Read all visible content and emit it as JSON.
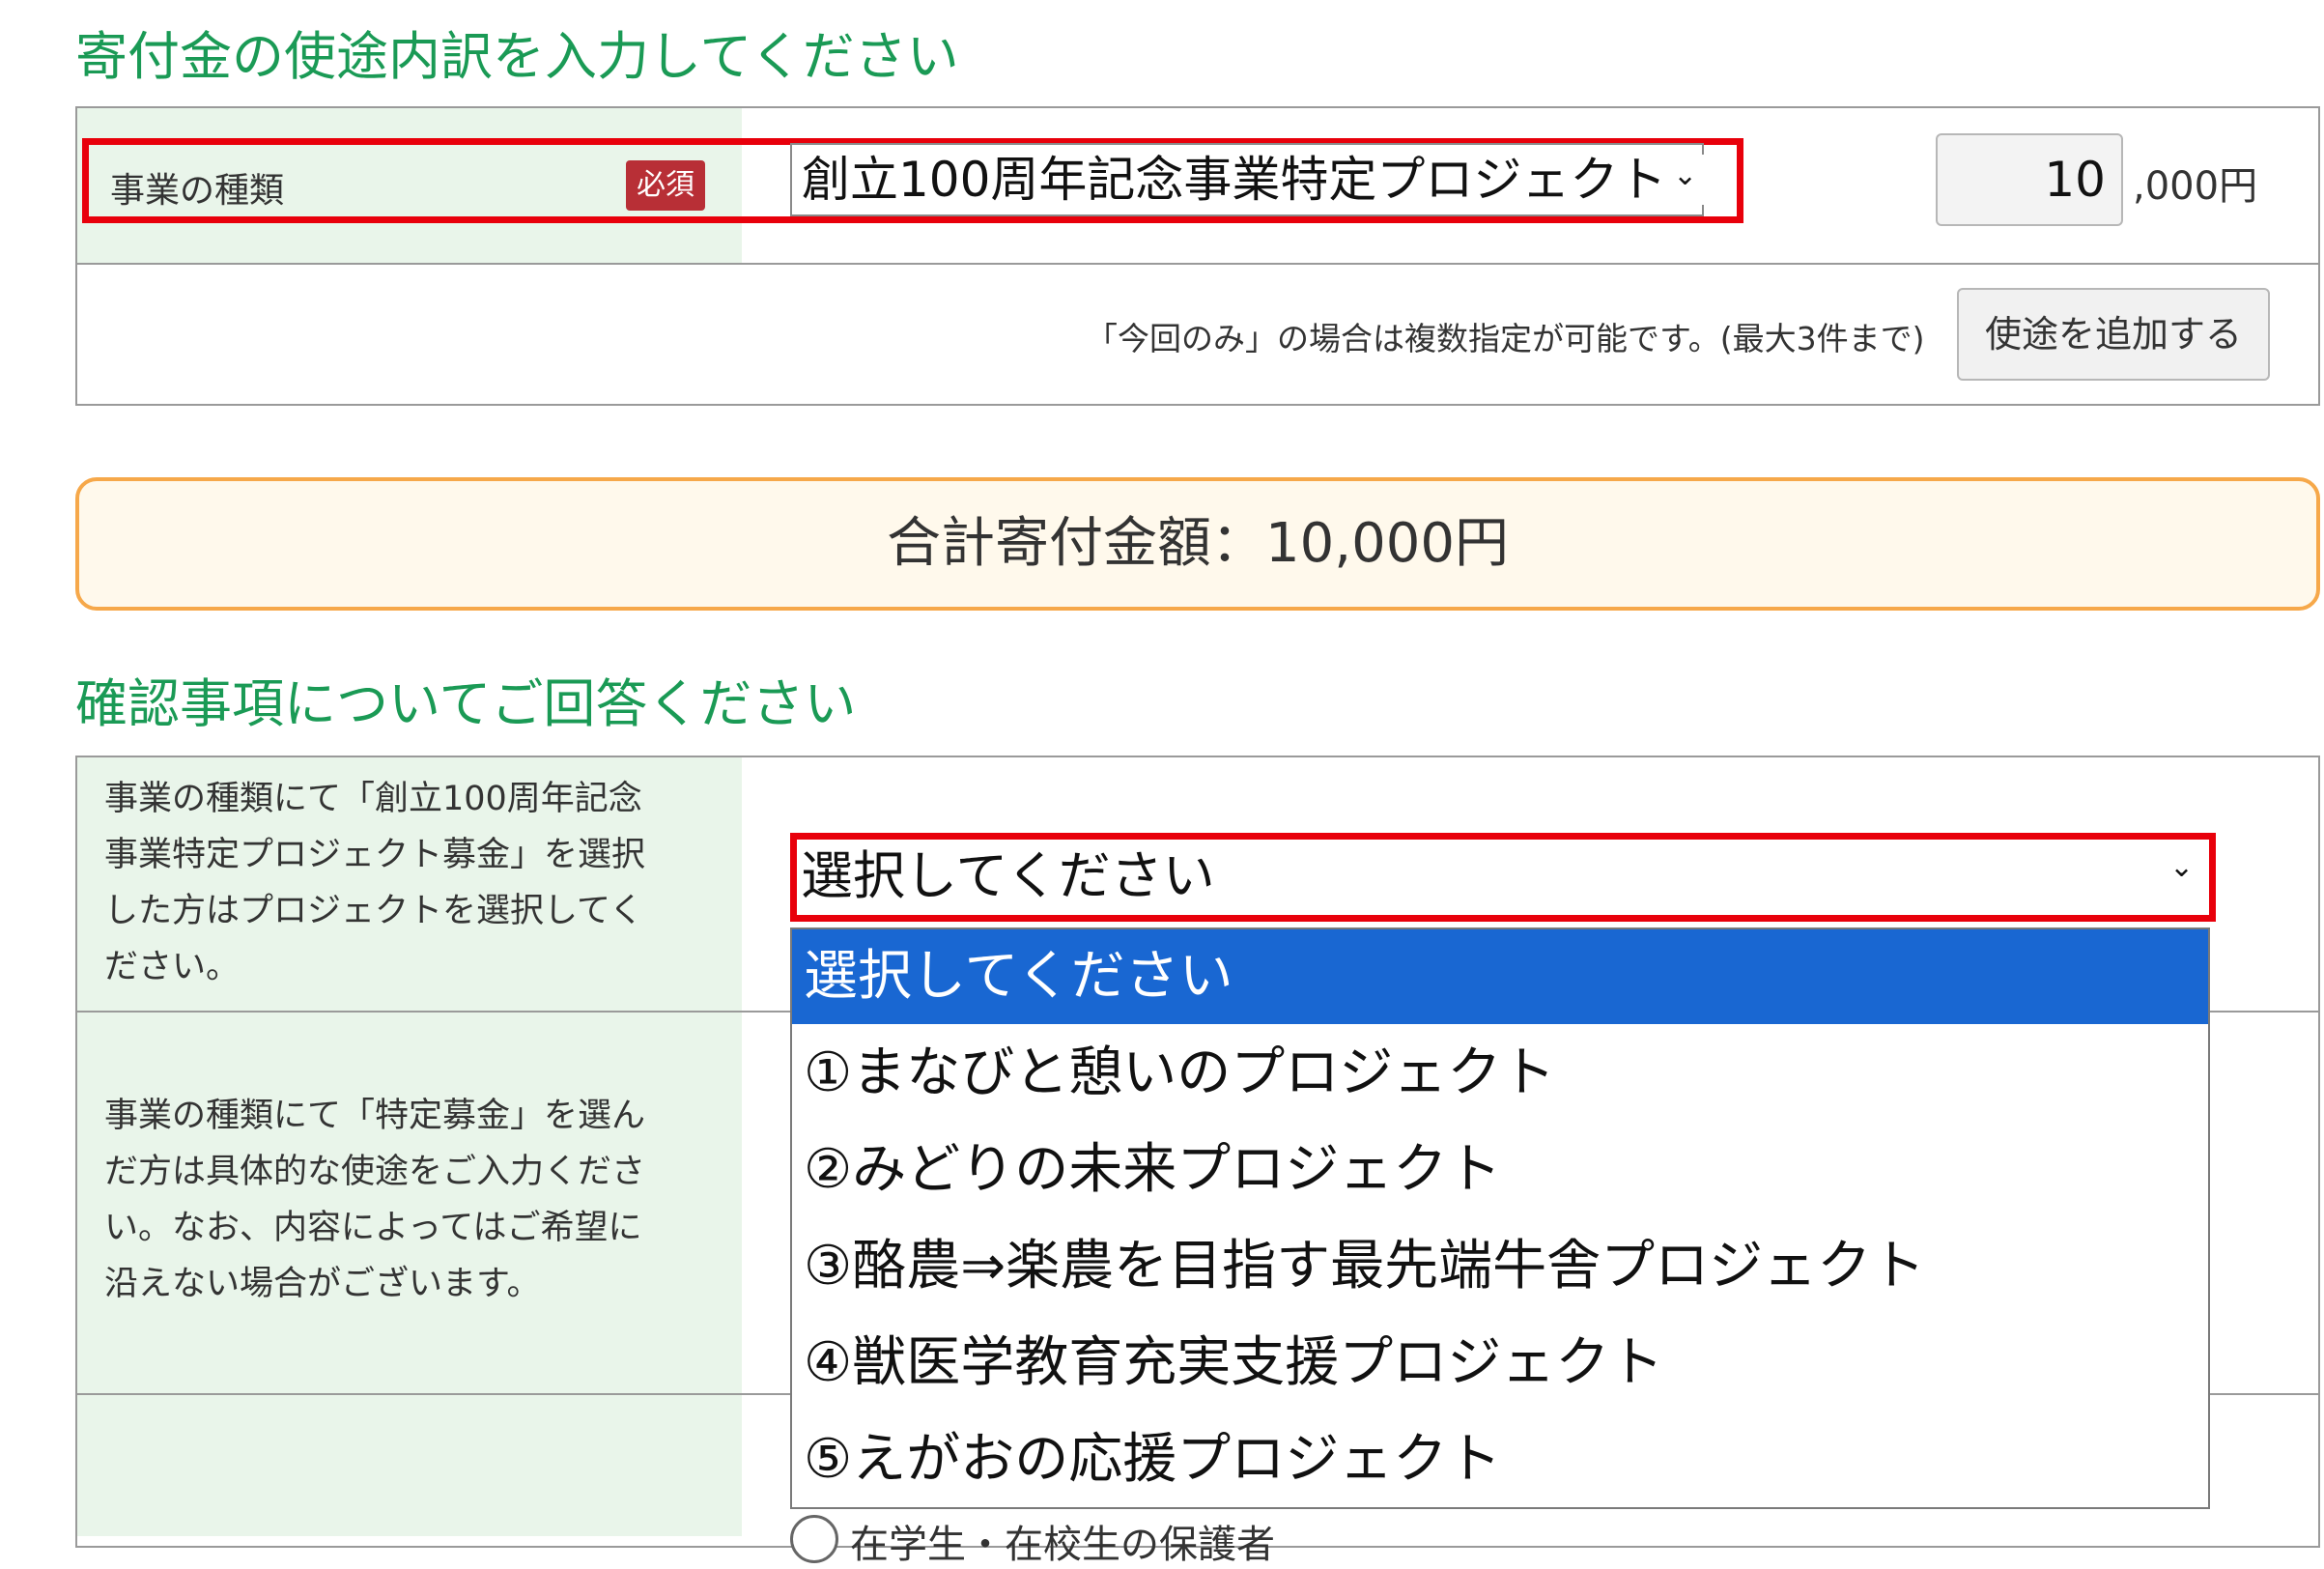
{
  "section1": {
    "title": "寄付金の使途内訳を入力してください",
    "business_type_label": "事業の種類",
    "required_badge": "必須",
    "business_type_value": "創立100周年記念事業特定プロジェクト",
    "amount_value": "10",
    "amount_suffix": ",000円",
    "note": "「今回のみ」の場合は複数指定が可能です。(最大3件まで)",
    "add_button": "使途を追加する"
  },
  "total": {
    "text": "合計寄付金額：10,000円"
  },
  "section2": {
    "title": "確認事項についてご回答ください",
    "q1_lines": [
      "事業の種類にて「創立100周年記念",
      "事業特定プロジェクト募金」を選択",
      "した方はプロジェクトを選択してく",
      "ださい。"
    ],
    "q1_select_value": "選択してください",
    "q2_lines": [
      "事業の種類にて「特定募金」を選ん",
      "だ方は具体的な使途をご入力くださ",
      "い。なお、内容によってはご希望に",
      "沿えない場合がございます。"
    ],
    "partial_radio_text": "在学生・在校生の保護者"
  },
  "dropdown": {
    "options": [
      "選択してください",
      "①まなびと憩いのプロジェクト",
      "②みどりの未来プロジェクト",
      "③酪農⇒楽農を目指す最先端牛舎プロジェクト",
      "④獣医学教育充実支援プロジェクト",
      "⑤えがおの応援プロジェクト"
    ],
    "selected_index": 0
  },
  "colors": {
    "heading": "#1a9a55",
    "label_bg": "#e9f5ea",
    "highlight_red": "#e8000b",
    "badge": "#b82f36",
    "total_border": "#f6a84a",
    "total_bg": "#fff9ec",
    "option_selected": "#1967d2"
  }
}
